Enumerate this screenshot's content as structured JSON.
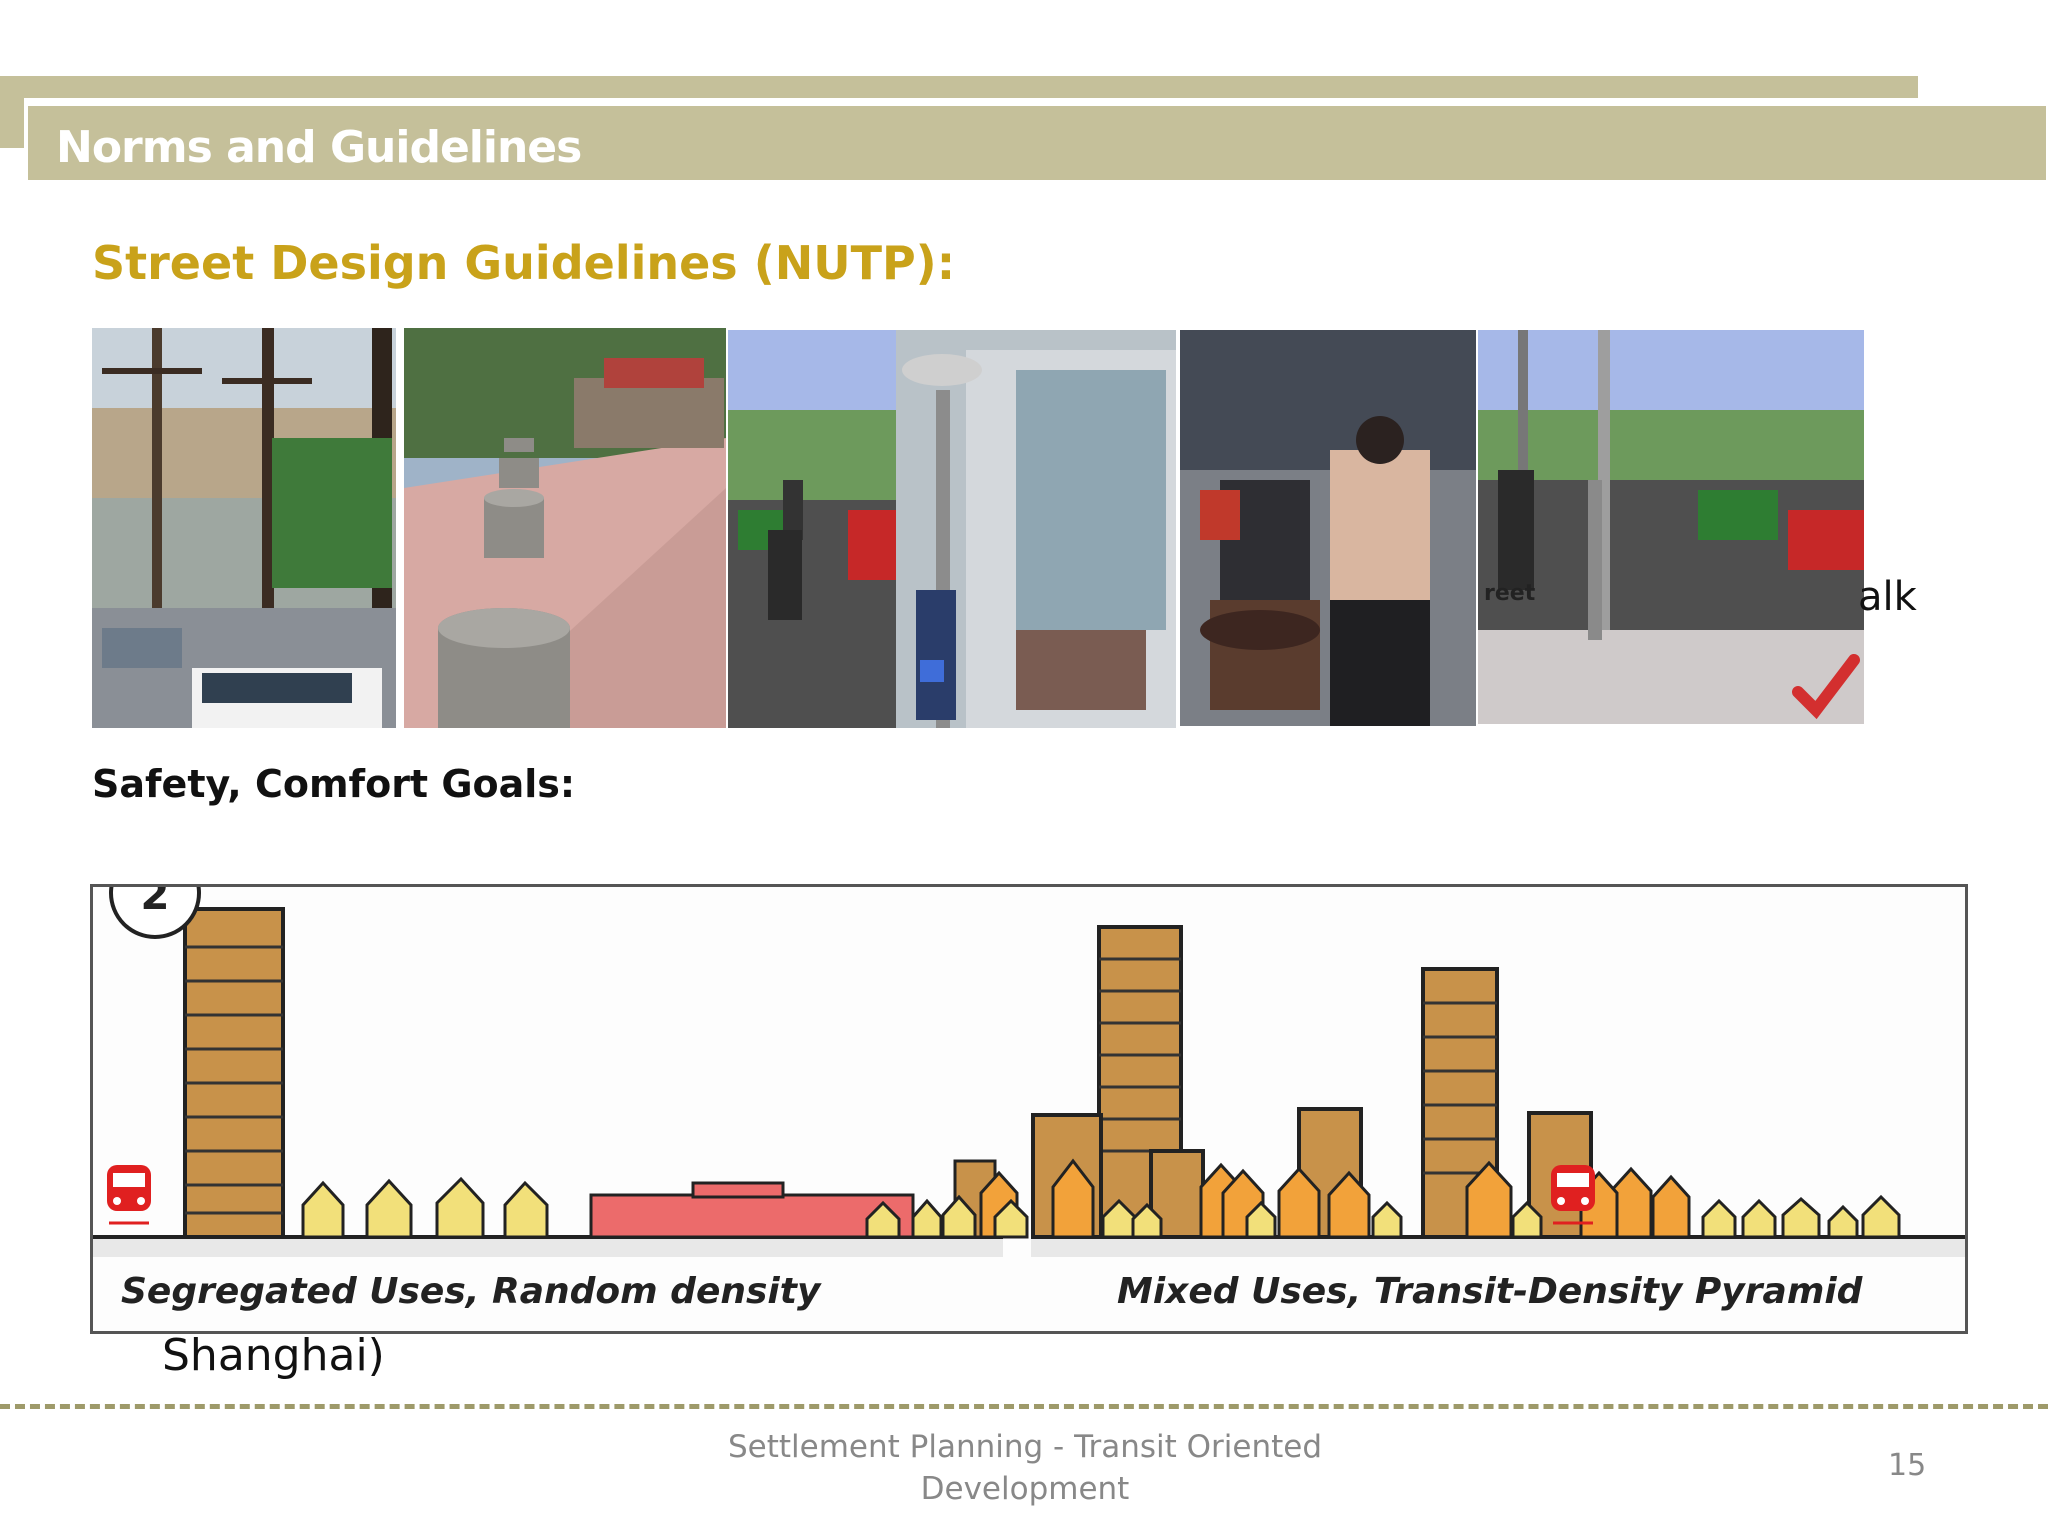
{
  "header": {
    "title": "Norms and Guidelines"
  },
  "section": {
    "heading": "Street Design Guidelines (NUTP):",
    "goals_heading": "Safety, Comfort Goals:"
  },
  "photos": {
    "partial_text_1": "alk",
    "partial_text_2": "Shanghai)",
    "sign_text": "reet"
  },
  "diagram": {
    "badge": "2",
    "left_caption": "Segregated Uses, Random density",
    "right_caption": "Mixed Uses, Transit-Density Pyramid"
  },
  "footer": {
    "line1": "Settlement Planning - Transit Oriented",
    "line2": "Development",
    "page_number": "15"
  },
  "colors": {
    "band": "#c5c09a",
    "heading_gold": "#c9a21a",
    "building_tan": "#c8924a",
    "house_yellow": "#f2e07a",
    "commercial_red": "#ec6b6b",
    "train_red": "#e02020"
  }
}
